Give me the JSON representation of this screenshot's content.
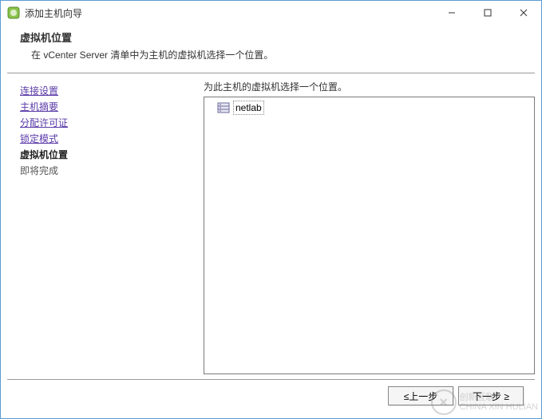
{
  "window": {
    "title": "添加主机向导"
  },
  "header": {
    "title": "虚拟机位置",
    "subtitle": "在 vCenter Server 清单中为主机的虚拟机选择一个位置。"
  },
  "sidebar": {
    "items": [
      {
        "label": "连接设置",
        "state": "done"
      },
      {
        "label": "主机摘要",
        "state": "done"
      },
      {
        "label": "分配许可证",
        "state": "done"
      },
      {
        "label": "锁定模式",
        "state": "done"
      },
      {
        "label": "虚拟机位置",
        "state": "current"
      },
      {
        "label": "即将完成",
        "state": "upcoming"
      }
    ]
  },
  "main": {
    "instruction": "为此主机的虚拟机选择一个位置。",
    "tree": [
      {
        "label": "netlab",
        "icon": "datacenter-icon"
      }
    ]
  },
  "footer": {
    "back": "≤上一步",
    "next": "下一步 ≥"
  },
  "watermark": {
    "brand_cn": "创新互联",
    "brand_en": "CHINA XIN HULIAN"
  }
}
